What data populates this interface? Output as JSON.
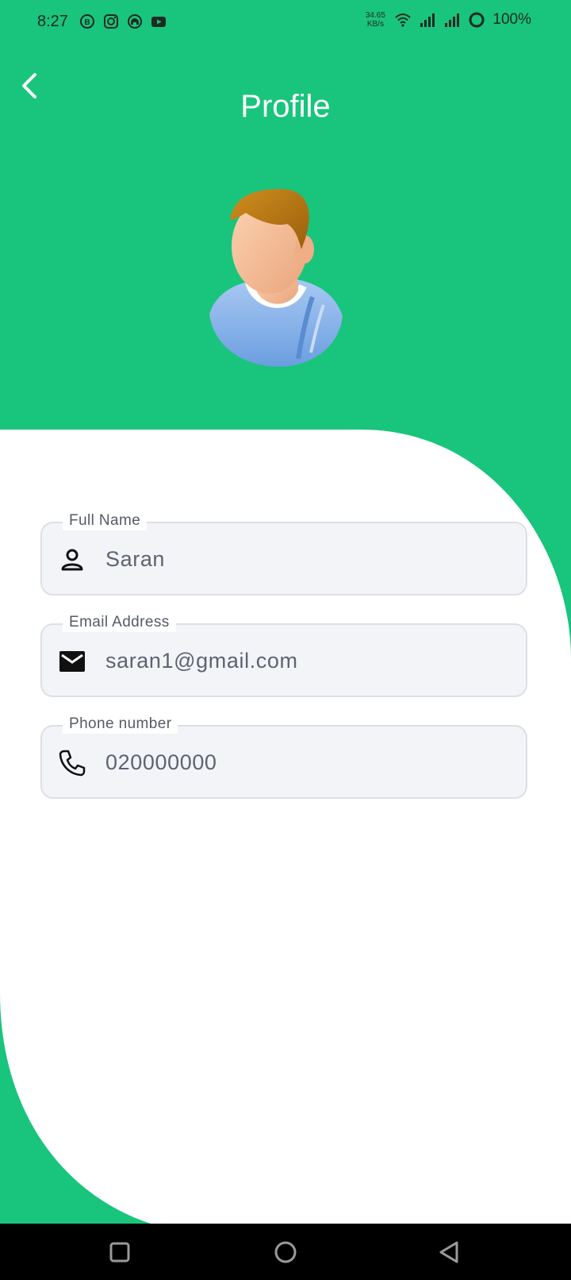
{
  "status_bar": {
    "time": "8:27",
    "app_icons": [
      "bold-b-icon",
      "instagram-icon",
      "headset-icon",
      "youtube-icon"
    ],
    "net_speed_value": "34.65",
    "net_speed_unit": "KB/s",
    "battery_percent": "100%"
  },
  "header": {
    "title": "Profile",
    "back_icon": "chevron-left-icon"
  },
  "fields": [
    {
      "label": "Full Name",
      "value": "Saran",
      "icon": "person-icon"
    },
    {
      "label": "Email Address",
      "value": "saran1@gmail.com",
      "icon": "mail-icon"
    },
    {
      "label": "Phone number",
      "value": "020000000",
      "icon": "phone-icon"
    }
  ],
  "nav": {
    "recents_icon": "square-icon",
    "home_icon": "circle-icon",
    "back_icon": "triangle-back-icon"
  },
  "colors": {
    "brand_green": "#19c47c",
    "field_background": "#f3f4f8",
    "field_border": "#dcdfe6"
  }
}
